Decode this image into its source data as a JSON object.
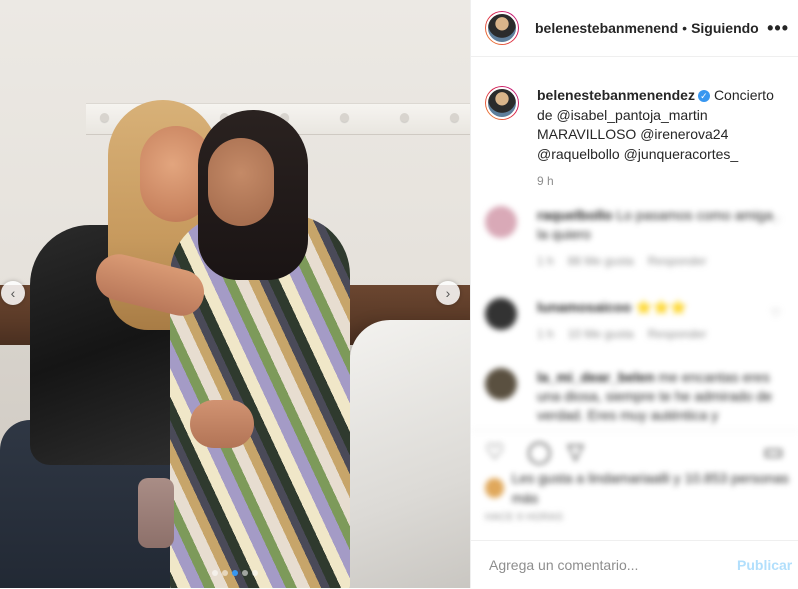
{
  "post": {
    "username_header": "belenestebanmenend",
    "separator": "•",
    "follow_state": "Siguiendo",
    "more_glyph": "•••",
    "caption_user": "belenestebanmenendez",
    "verified_glyph": "✓",
    "caption_text": "Concierto de @isabel_pantoja_martin MARAVILLOSO @irenerova24 @raquelbollo @junqueracortes_",
    "time": "9 h"
  },
  "carousel": {
    "prev_glyph": "‹",
    "next_glyph": "›",
    "slides": 5,
    "active_slide": 3
  },
  "comments": [
    {
      "user": "raquelbollo",
      "text": "Lo pasamos como amiga la quiero",
      "meta": [
        "1 h",
        "88 Me gusta",
        "Responder"
      ],
      "avatar_color": "#d9a9b7"
    },
    {
      "user": "lunamosaicoo",
      "text": "⭐⭐⭐",
      "meta": [
        "1 h",
        "10 Me gusta",
        "Responder"
      ],
      "avatar_color": "#333333"
    },
    {
      "user": "la_mi_dear_belen",
      "text": "me encantas eres una diosa, siempre te he admirado de verdad. Eres muy auténtica y",
      "meta": [],
      "avatar_color": "#5a5040"
    }
  ],
  "actions": {
    "like_glyph": "♡",
    "comment_glyph": "◯",
    "share_glyph": "▽",
    "save_glyph": "▭"
  },
  "likes": {
    "text": "Les gusta a lindamariaalli y 10.853 personas más"
  },
  "date_text": "HACE 9 HORAS",
  "comment_box": {
    "placeholder": "Agrega un comentario...",
    "publish_label": "Publicar"
  },
  "colors": {
    "accent": "#3897f0",
    "publish_disabled": "#b2dffc",
    "muted": "#8e8e8e"
  }
}
